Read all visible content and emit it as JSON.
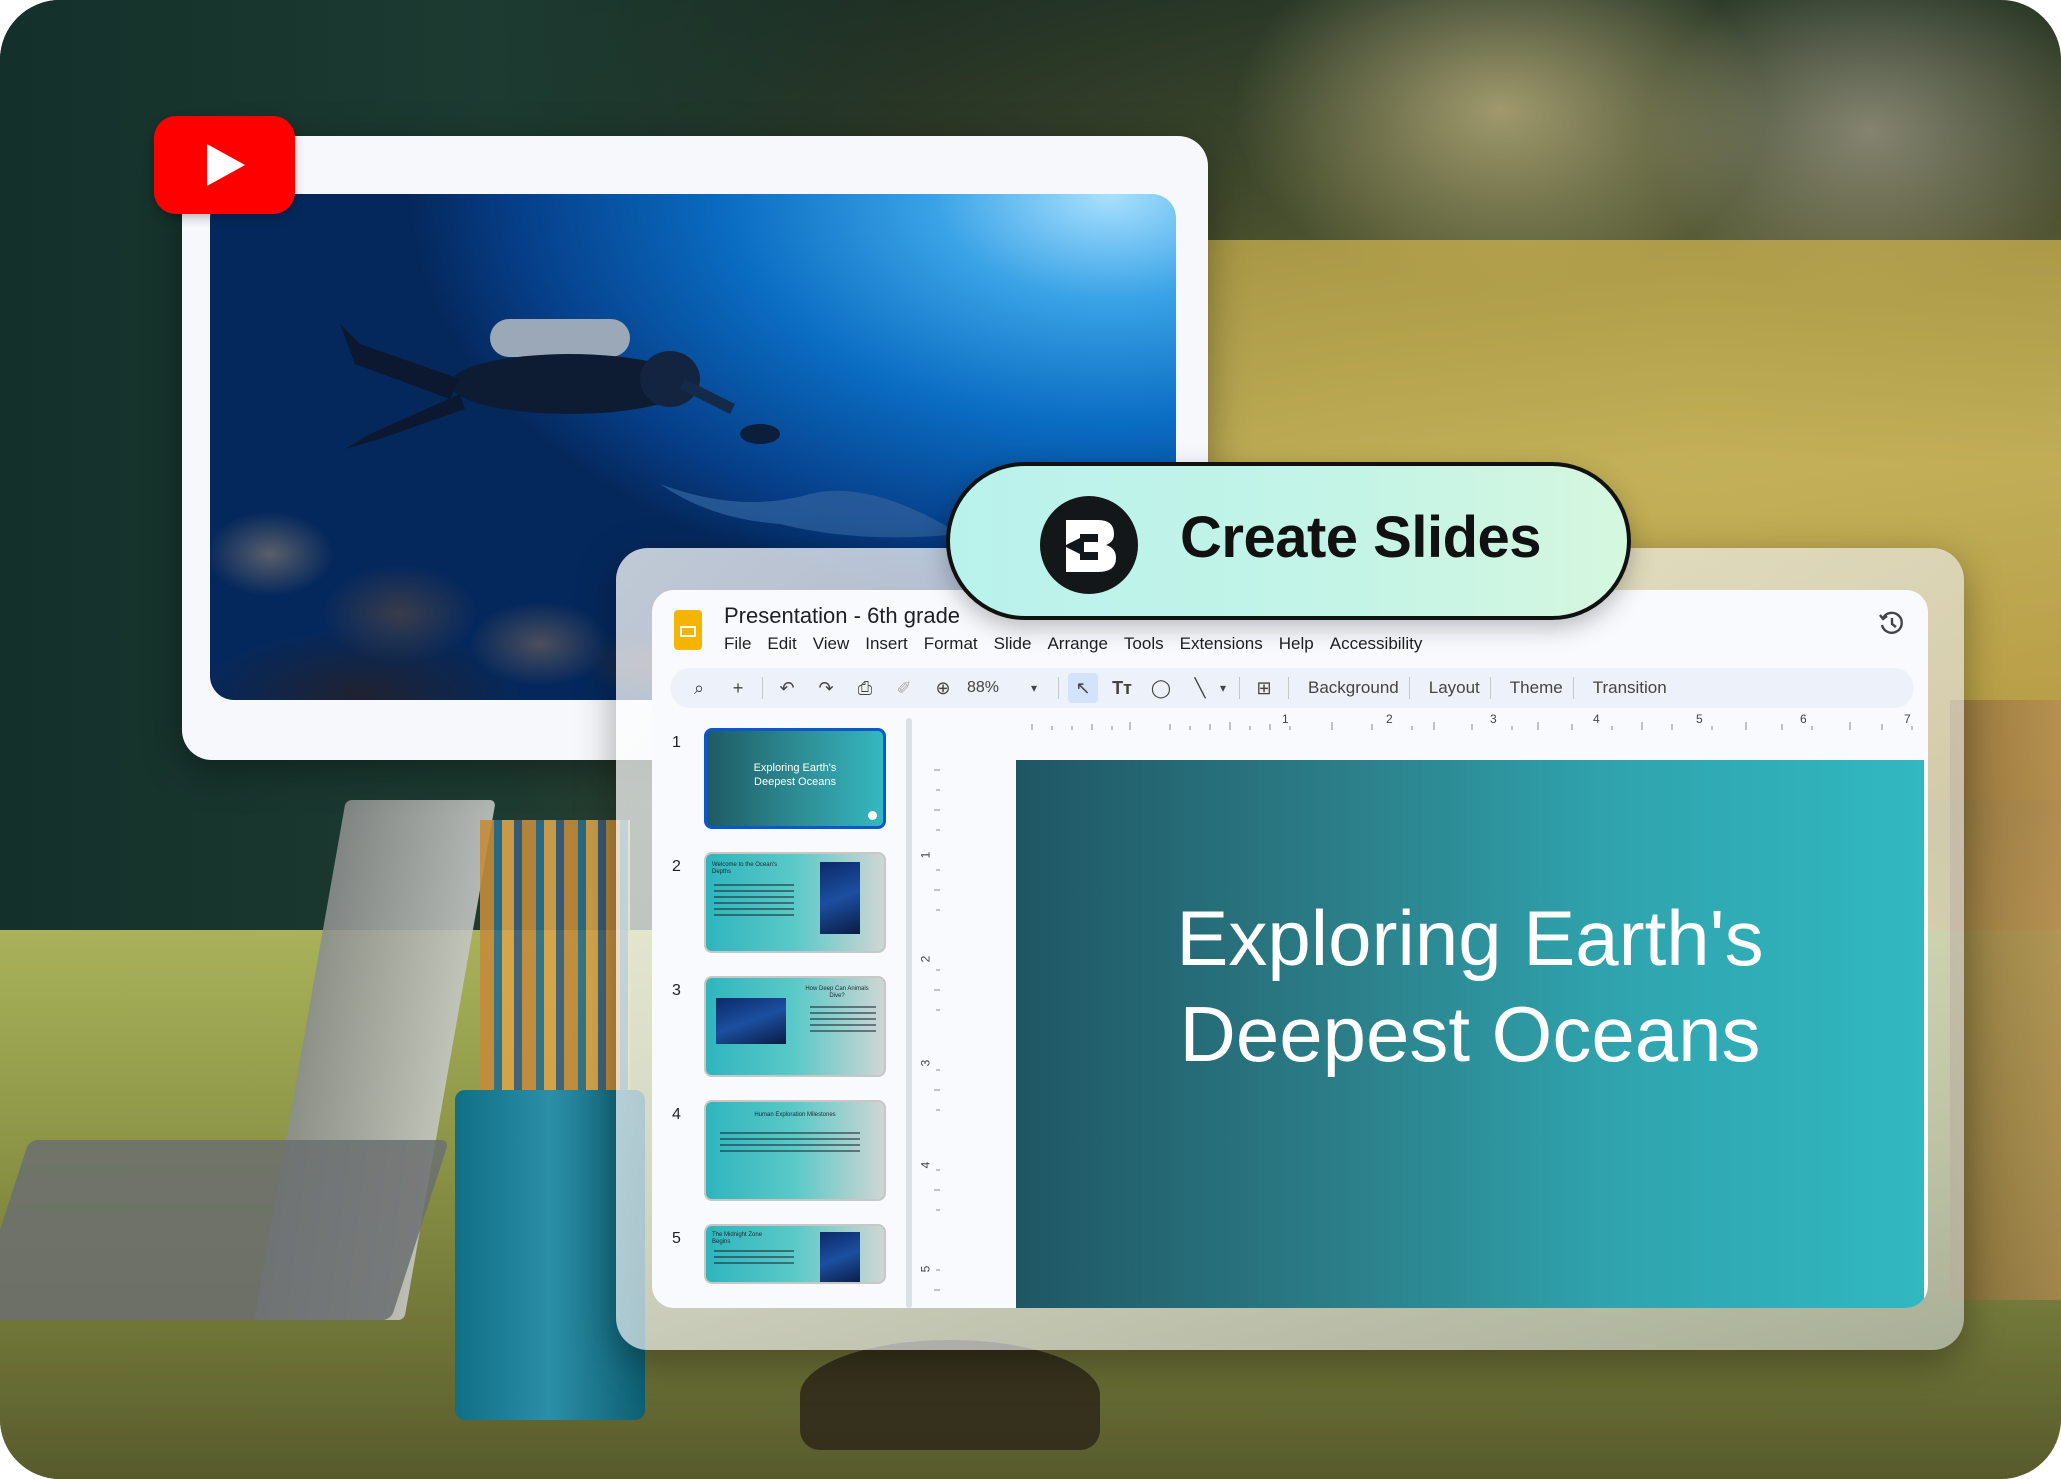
{
  "background": {
    "scene": "classroom"
  },
  "youtube_card": {
    "logo_icon": "youtube-play-icon",
    "brand_color": "#ff0000"
  },
  "create_button": {
    "label": "Create Slides",
    "logo_icon": "brisk-b-icon",
    "bg_color": "#c4f4e6"
  },
  "slides_app": {
    "title": "Presentation - 6th grade",
    "menu": [
      "File",
      "Edit",
      "View",
      "Insert",
      "Format",
      "Slide",
      "Arrange",
      "Tools",
      "Extensions",
      "Help",
      "Accessibility"
    ],
    "toolbar": {
      "zoom": "88%",
      "background": "Background",
      "layout": "Layout",
      "theme": "Theme",
      "transition": "Transition"
    },
    "ruler_top": [
      "1",
      "2",
      "3",
      "4",
      "5",
      "6",
      "7"
    ],
    "ruler_left": [
      "1",
      "2",
      "3",
      "4",
      "5"
    ],
    "slides": [
      {
        "num": "1",
        "title": "Exploring Earth's Deepest Oceans"
      },
      {
        "num": "2",
        "title": "Welcome to the Ocean's Depths"
      },
      {
        "num": "3",
        "title": "How Deep Can Animals Dive?"
      },
      {
        "num": "4",
        "title": "Human Exploration Milestones"
      },
      {
        "num": "5",
        "title": "The Midnight Zone Begins"
      }
    ],
    "current_slide": {
      "line1": "Exploring Earth's",
      "line2": "Deepest Oceans"
    },
    "accent_color": "#0b57d0"
  }
}
